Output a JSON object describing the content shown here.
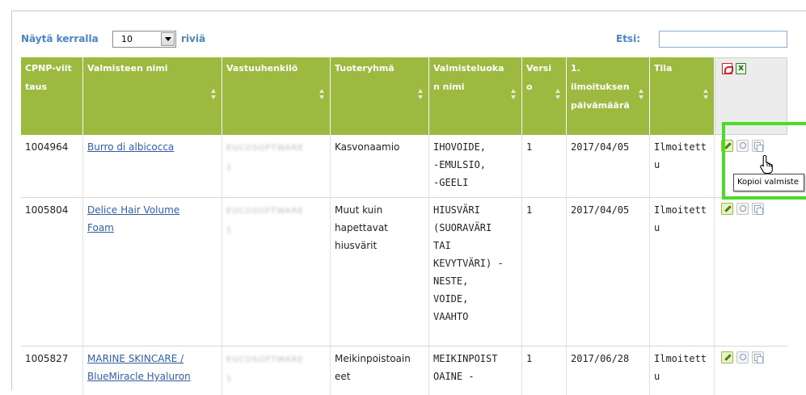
{
  "controls": {
    "show_label": "Näytä kerralla",
    "page_size": "10",
    "rows_label": "riviä",
    "search_label": "Etsi:",
    "search_value": ""
  },
  "columns": [
    {
      "label": "CPNP-viit\ntaus",
      "sortable": false
    },
    {
      "label": "Valmisteen nimi",
      "sortable": true
    },
    {
      "label": "Vastuuhenkilö",
      "sortable": true
    },
    {
      "label": "Tuoteryhmä",
      "sortable": true
    },
    {
      "label": "Valmisteluoka\nn nimi",
      "sortable": true
    },
    {
      "label": "Versi\no",
      "sortable": true
    },
    {
      "label": "1.\nilmoituksen\npäivämäärä",
      "sortable": true
    },
    {
      "label": "Tila",
      "sortable": true
    }
  ],
  "export_icons": [
    "pdf-icon",
    "excel-icon"
  ],
  "rows": [
    {
      "ref": "1004964",
      "name": "Burro di albicocca",
      "responsible": "EUCOSOFTWARE\n1",
      "group": "Kasvonaamio",
      "category": "IHOVOIDE,\n-EMULSIO,\n-GEELI",
      "version": "1",
      "date": "2017/04/05",
      "status": "Ilmoitett\nu"
    },
    {
      "ref": "1005804",
      "name": "Delice Hair Volume\nFoam",
      "responsible": "EUCOSOFTWARE\n1",
      "group": "Muut kuin\nhapettavat\nhiusvärit",
      "category": "HIUSVÄRI\n(SUORAVÄRI\nTAI\nKEVYTVÄRI) -\nNESTE,\nVOIDE,\nVAAHTO",
      "version": "1",
      "date": "2017/04/05",
      "status": "Ilmoitett\nu"
    },
    {
      "ref": "1005827",
      "name": "MARINE SKINCARE /\nBlueMiracle Hyaluron",
      "responsible": "EUCOSOFTWARE\n1",
      "group": "Meikinpoistoain\neet",
      "category": "MEIKINPOIST\nOAINE -",
      "version": "1",
      "date": "2017/06/28",
      "status": "Ilmoitett\nu"
    }
  ],
  "row_action_icons": [
    "edit-icon",
    "view-icon",
    "copy-icon"
  ],
  "tooltip": "Kopioi valmiste",
  "colors": {
    "header_bg": "#9bba3f",
    "label_blue": "#4a86c5",
    "link_blue": "#2e5eab",
    "highlight": "#4cdc28"
  }
}
